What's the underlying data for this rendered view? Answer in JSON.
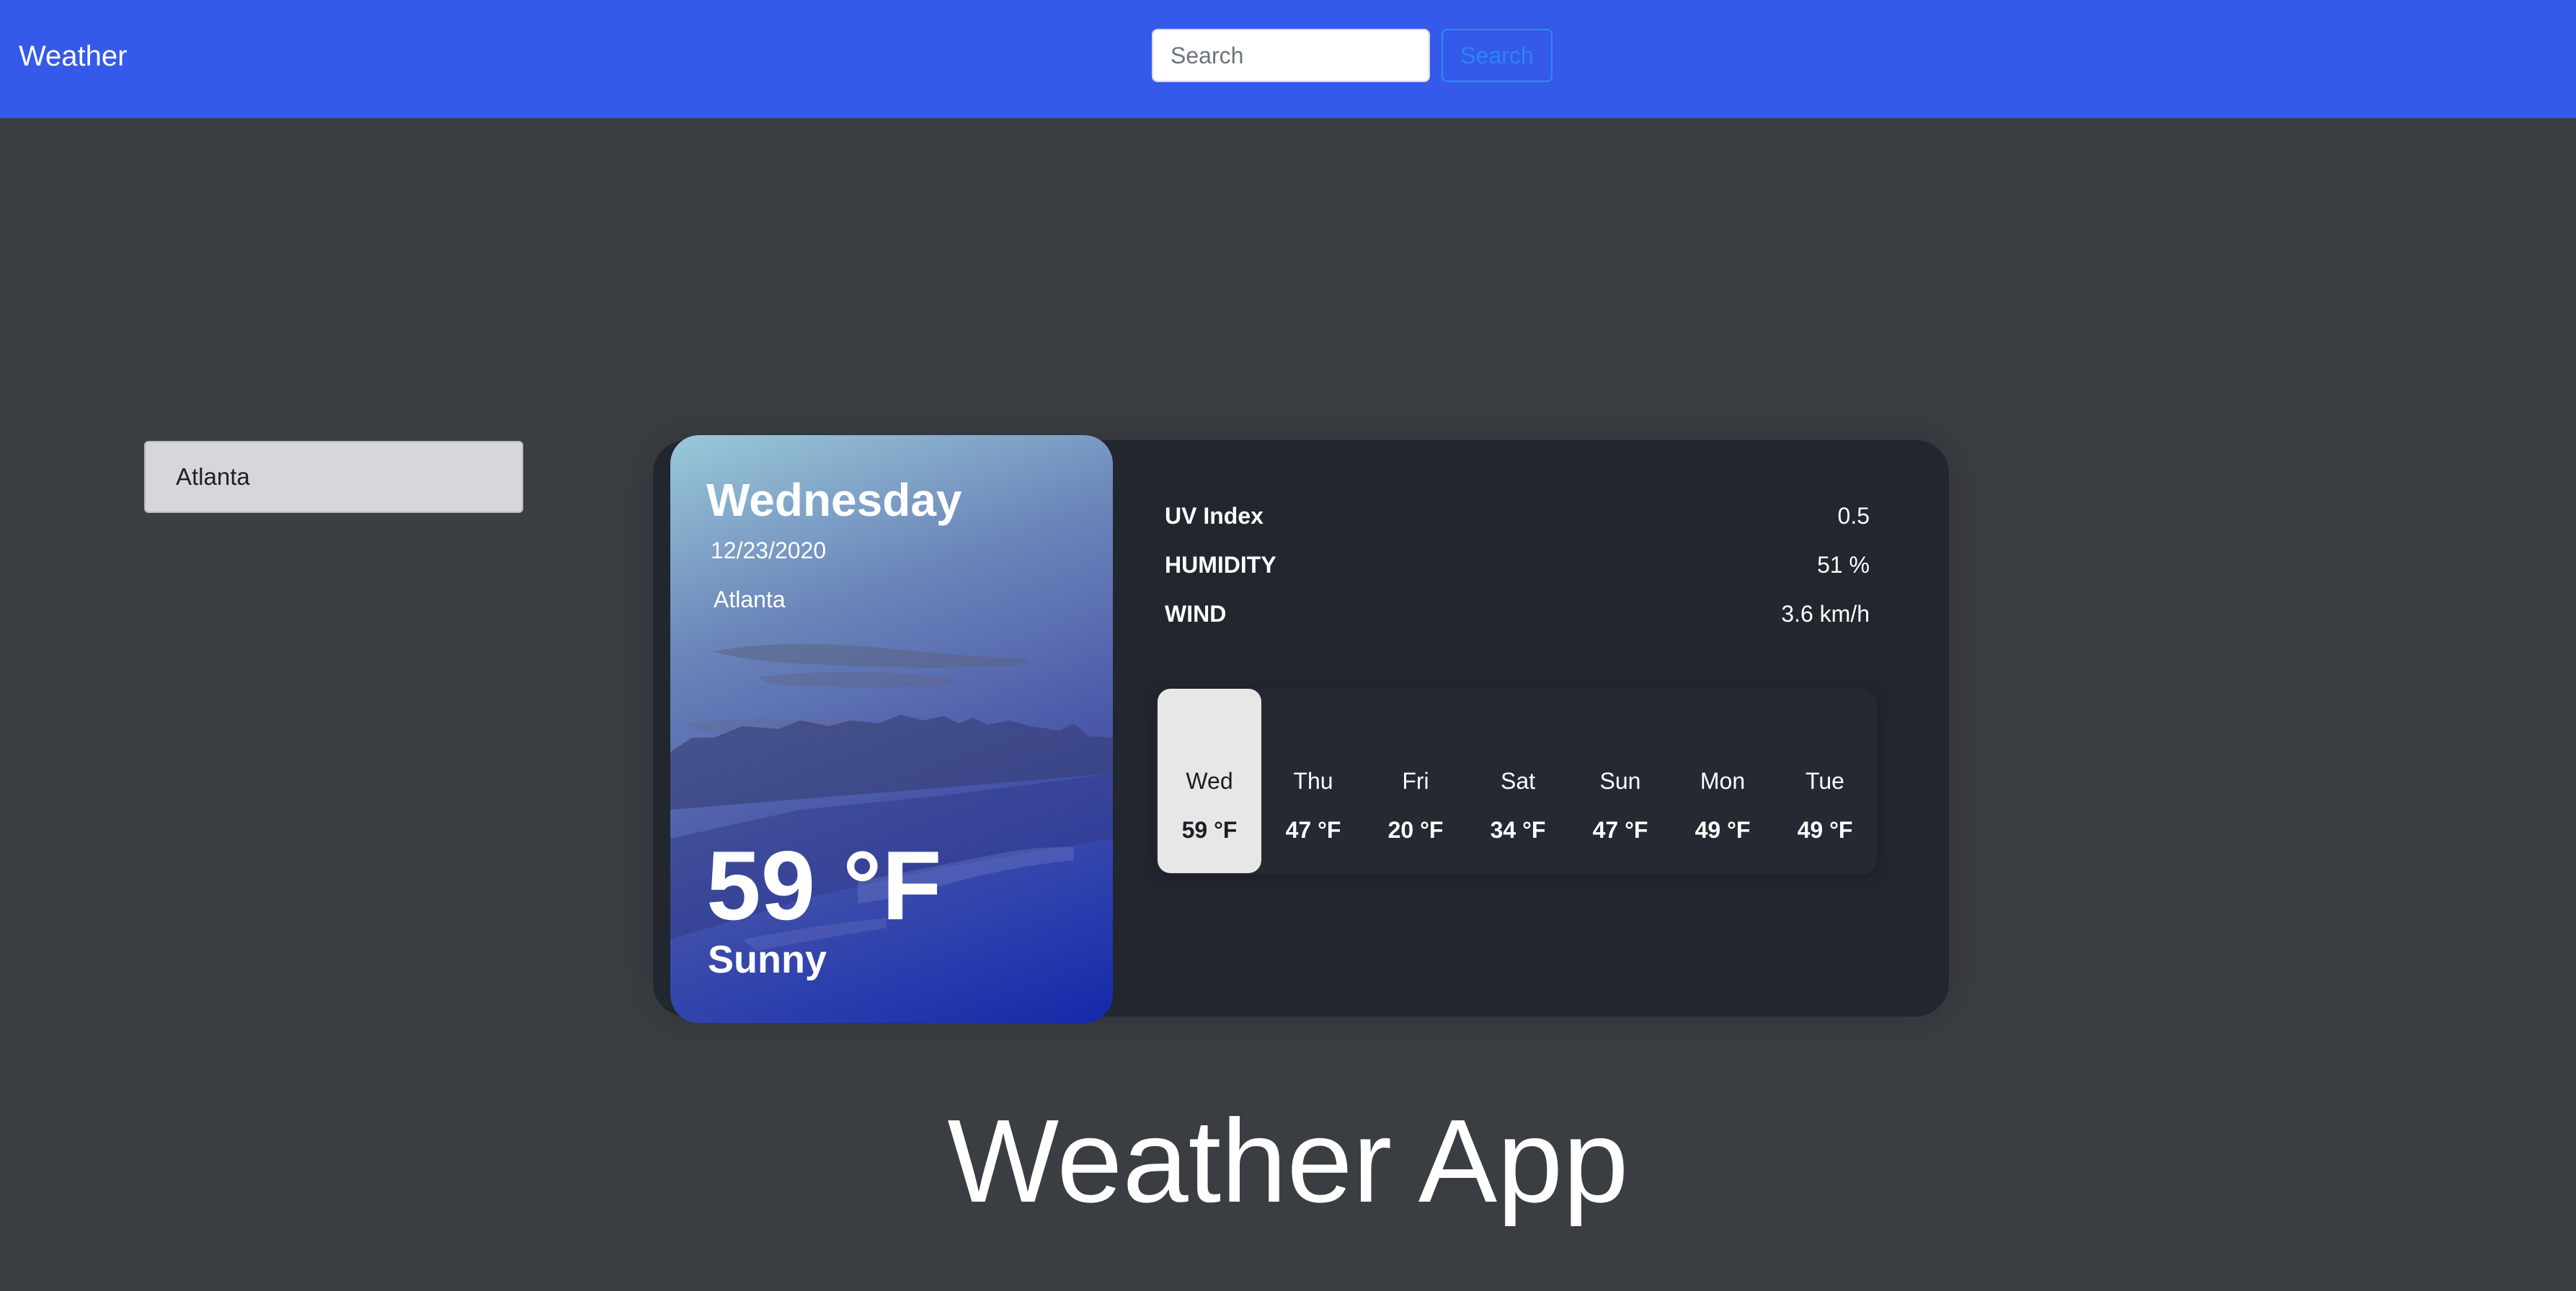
{
  "navbar": {
    "brand": "Weather",
    "search_placeholder": "Search",
    "search_button": "Search"
  },
  "cities": [
    {
      "label": "Atlanta"
    }
  ],
  "today": {
    "day": "Wednesday",
    "date": "12/23/2020",
    "city": "Atlanta",
    "temperature": "59 °F",
    "condition": "Sunny"
  },
  "info": [
    {
      "label": "UV Index",
      "value": "0.5"
    },
    {
      "label": "HUMIDITY",
      "value": "51 %"
    },
    {
      "label": "WIND",
      "value": "3.6 km/h"
    }
  ],
  "forecast": [
    {
      "day": "Wed",
      "temp": "59 °F",
      "active": true
    },
    {
      "day": "Thu",
      "temp": "47 °F",
      "active": false
    },
    {
      "day": "Fri",
      "temp": "20 °F",
      "active": false
    },
    {
      "day": "Sat",
      "temp": "34 °F",
      "active": false
    },
    {
      "day": "Sun",
      "temp": "47 °F",
      "active": false
    },
    {
      "day": "Mon",
      "temp": "49 °F",
      "active": false
    },
    {
      "day": "Tue",
      "temp": "49 °F",
      "active": false
    }
  ],
  "footer": {
    "title": "Weather App"
  },
  "colors": {
    "navbar": "#3559e9",
    "background": "#3a3d42",
    "card": "#22262e",
    "search_button_border": "#2c8cf0"
  }
}
